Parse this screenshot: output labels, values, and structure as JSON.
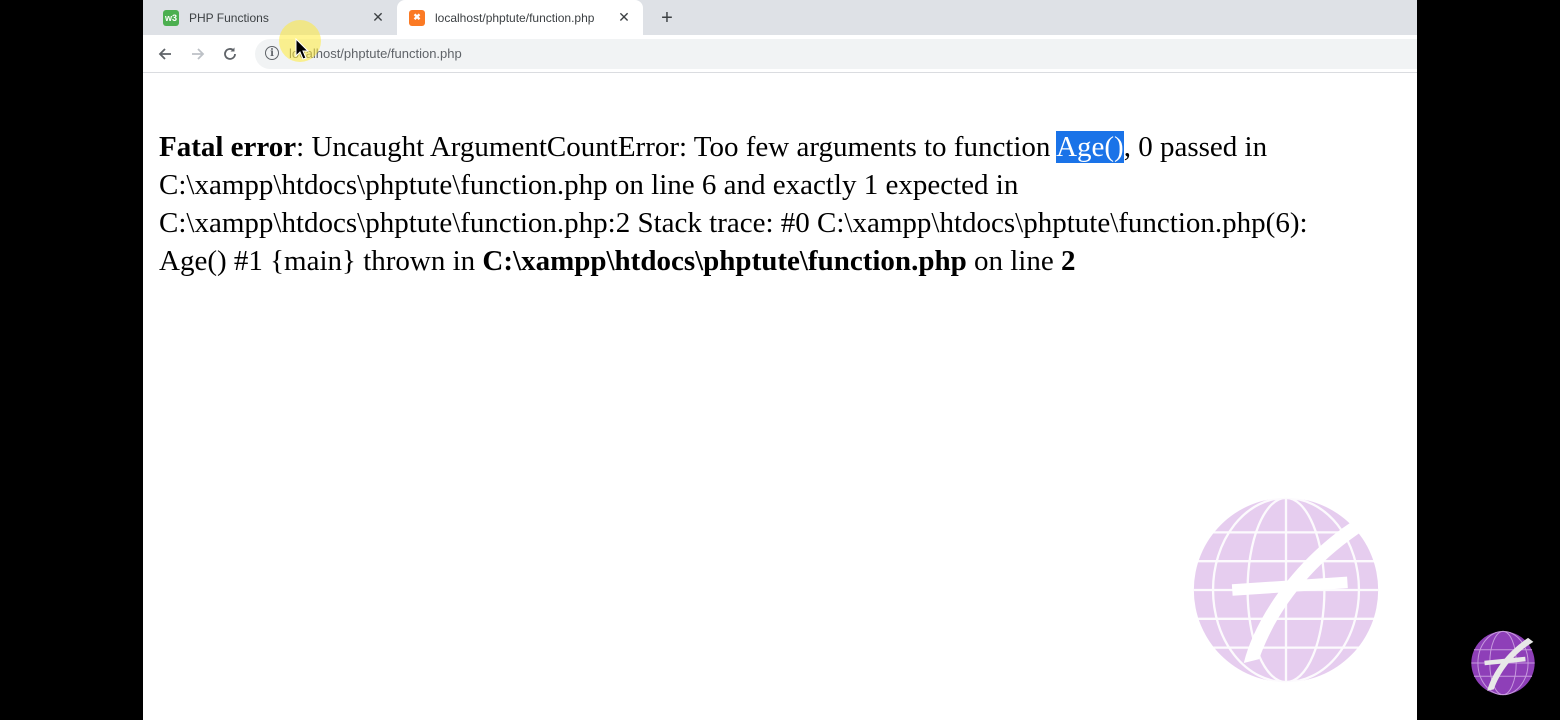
{
  "tabs": [
    {
      "title": "PHP Functions",
      "favicon": "w3schools-favicon",
      "active": false
    },
    {
      "title": "localhost/phptute/function.php",
      "favicon": "xampp-favicon",
      "active": true
    }
  ],
  "newtab_symbol": "+",
  "address_bar": {
    "url": "localhost/phptute/function.php"
  },
  "error": {
    "line1_label": "Fatal error",
    "line1_text": ": Uncaught ArgumentCountError: Too few arguments to function ",
    "line1_highlight": "Age()",
    "line1_rest": ", 0 passed in",
    "line2": "C:\\xampp\\htdocs\\phptute\\function.php on line 6 and exactly 1 expected in",
    "line3": "C:\\xampp\\htdocs\\phptute\\function.php:2 Stack trace: #0 C:\\xampp\\htdocs\\phptute\\function.php(6):",
    "line4_text": "Age() #1 {main} thrown in ",
    "line4_file": "C:\\xampp\\htdocs\\phptute\\function.php",
    "line4_mid": " on line ",
    "line4_line": "2"
  },
  "colors": {
    "highlight": "#1a73e8",
    "watermark": "#c9a0dc"
  }
}
